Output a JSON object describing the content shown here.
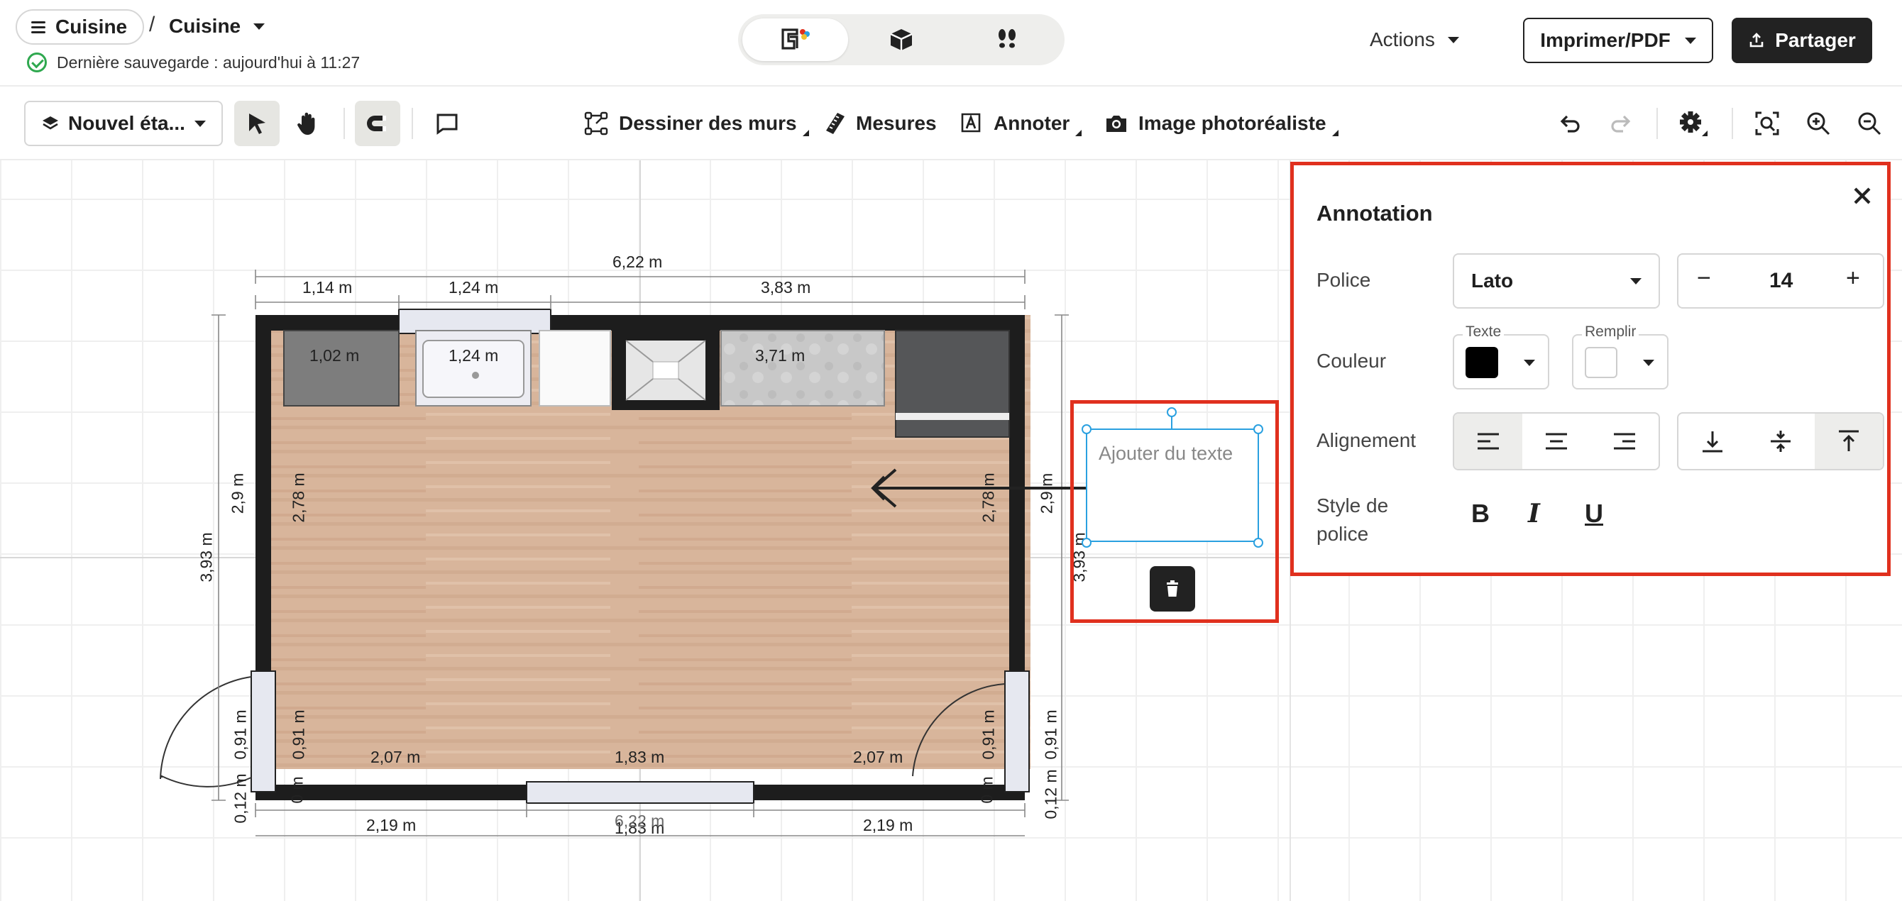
{
  "header": {
    "menu_label": "Cuisine",
    "separator": "/",
    "page_name": "Cuisine",
    "save_status": "Dernière sauvegarde : aujourd'hui à 11:27",
    "view_modes": [
      "2d-plan-view",
      "3d-view",
      "walkthrough-view"
    ],
    "actions_label": "Actions",
    "print_label": "Imprimer/PDF",
    "share_label": "Partager"
  },
  "toolbar": {
    "level_label": "Nouvel éta...",
    "draw_walls_label": "Dessiner des murs",
    "measures_label": "Mesures",
    "annotate_label": "Annoter",
    "photo_label": "Image photoréaliste"
  },
  "plan": {
    "top_total": "6,22 m",
    "top_segments": [
      "1,14 m",
      "1,24 m",
      "3,83 m"
    ],
    "counter_lengths": [
      "1,02 m",
      "1,24 m",
      "3,71 m"
    ],
    "left_total": "3,93 m",
    "left_outer": "2,9 m",
    "left_inner": "2,78 m",
    "left_door_outer": "0,91 m",
    "left_door_inner": "0,91 m",
    "left_small_outer": "0,12 m",
    "left_small_inner": "0 m",
    "right_outer": "2,9 m",
    "right_inner": "2,78 m",
    "right_total": "3,93 m",
    "right_door_outer": "0,91 m",
    "right_door_inner": "0,91 m",
    "right_small_outer": "0,12 m",
    "right_small_inner": "0 m",
    "bottom_inner": [
      "2,07 m",
      "1,83 m",
      "2,07 m"
    ],
    "bottom_outer": [
      "2,19 m",
      "1,83 m",
      "2,19 m"
    ],
    "bottom_total": "6,22 m",
    "annotation_placeholder": "Ajouter du texte"
  },
  "panel": {
    "title": "Annotation",
    "font_label": "Police",
    "font_value": "Lato",
    "size_value": "14",
    "minus": "−",
    "plus": "+",
    "color_label": "Couleur",
    "text_color_caption": "Texte",
    "fill_color_caption": "Remplir",
    "text_color": "#000000",
    "fill_color": "#ffffff",
    "align_label": "Alignement",
    "style_label_1": "Style de",
    "style_label_2": "police",
    "bold": "B",
    "italic": "I",
    "underline": "U"
  },
  "colors": {
    "highlight": "#e0301e",
    "selection": "#2aa0e0",
    "dark": "#222222",
    "floor": "#d7b49a"
  }
}
